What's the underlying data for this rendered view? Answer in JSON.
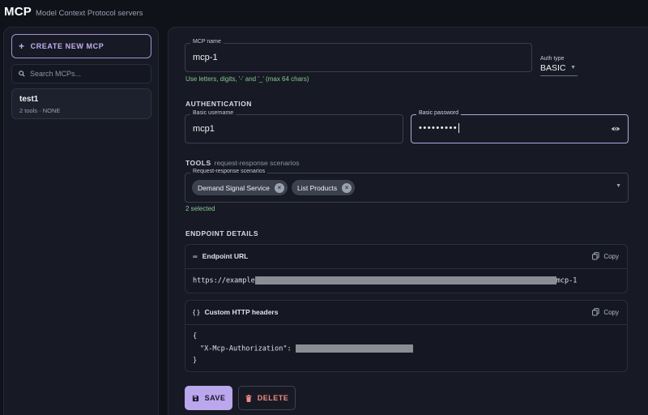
{
  "app": {
    "title": "MCP",
    "subtitle": "Model Context Protocol servers"
  },
  "sidebar": {
    "create_label": "CREATE NEW MCP",
    "search_placeholder": "Search MCPs...",
    "items": [
      {
        "name": "test1",
        "meta": "2 tools · NONE"
      }
    ]
  },
  "form": {
    "name_label": "MCP name",
    "name_value": "mcp-1",
    "name_hint": "Use letters, digits, '-' and '_' (max 64 chars)",
    "auth_type_label": "Auth type",
    "auth_type_value": "BASIC"
  },
  "authentication": {
    "title": "AUTHENTICATION",
    "username_label": "Basic username",
    "username_value": "mcp1",
    "password_label": "Basic password",
    "password_masked": "•••••••••"
  },
  "tools": {
    "title": "TOOLS",
    "subtitle": "request-response scenarios",
    "field_label": "Request-response scenarios",
    "chips": [
      "Demand Signal Service",
      "List Products"
    ],
    "selected_text": "2 selected"
  },
  "endpoint": {
    "title": "ENDPOINT DETAILS",
    "url_card_title": "Endpoint URL",
    "copy_label": "Copy",
    "url_prefix": "https://example",
    "url_suffix": "mcp-1",
    "headers_card_title": "Custom HTTP headers",
    "headers_open": "{",
    "header_key": "\"X-Mcp-Authorization\":",
    "headers_close": "}"
  },
  "actions": {
    "save_label": "SAVE",
    "delete_label": "DELETE"
  },
  "colors": {
    "accent": "#bba7ec",
    "success_text": "#86c78f",
    "danger_text": "#f08a86",
    "background": "#10121a",
    "panel": "#171a24"
  }
}
